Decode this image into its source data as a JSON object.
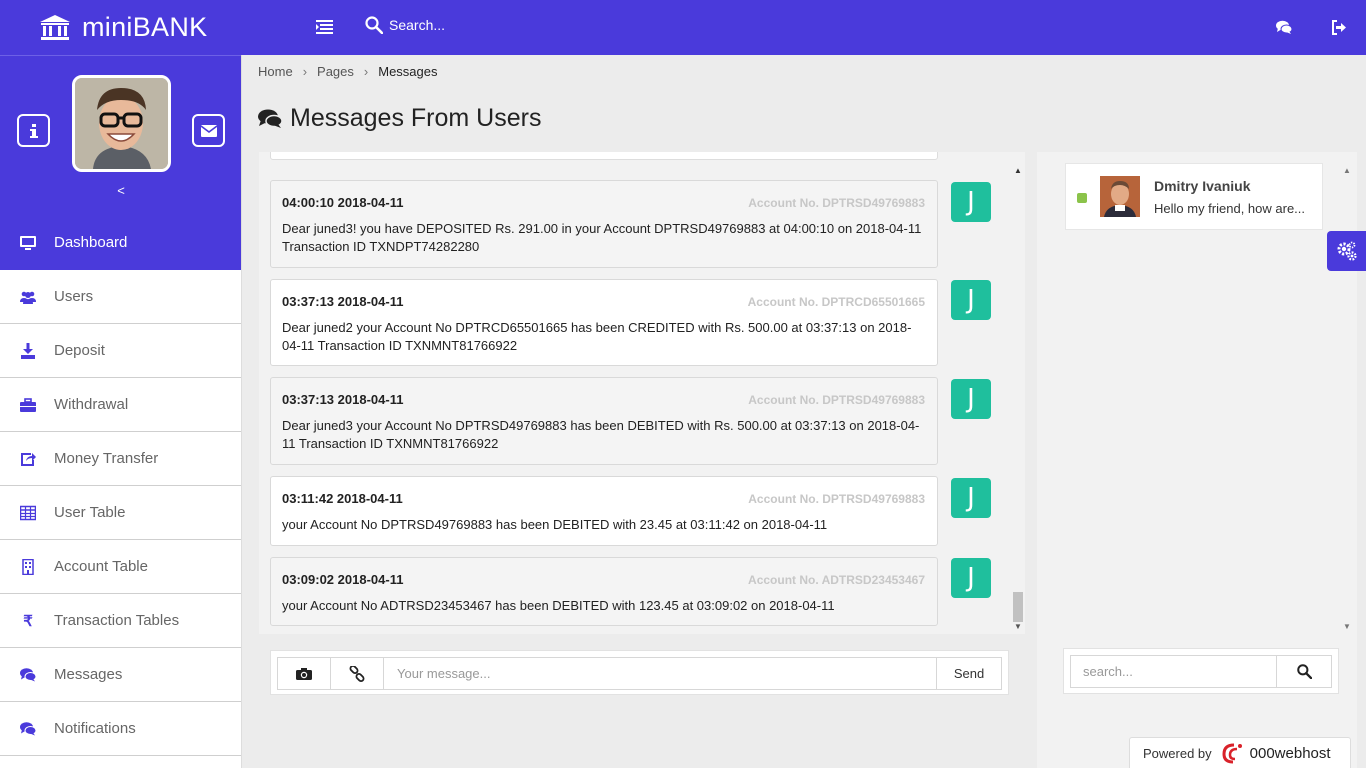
{
  "brand": {
    "name": "miniBANK"
  },
  "header": {
    "search_placeholder": "Search...",
    "icons": [
      "bank-icon",
      "menu-toggle-icon",
      "search-icon",
      "chat-icon",
      "logout-icon"
    ]
  },
  "profile": {
    "collapse_symbol": "<"
  },
  "sidebar": {
    "items": [
      {
        "label": "Dashboard",
        "icon": "desktop-icon",
        "active": true
      },
      {
        "label": "Users",
        "icon": "users-icon"
      },
      {
        "label": "Deposit",
        "icon": "download-icon"
      },
      {
        "label": "Withdrawal",
        "icon": "briefcase-icon"
      },
      {
        "label": "Money Transfer",
        "icon": "share-icon"
      },
      {
        "label": "User Table",
        "icon": "table-icon"
      },
      {
        "label": "Account Table",
        "icon": "building-icon"
      },
      {
        "label": "Transaction Tables",
        "icon": "rupee-icon",
        "glyph": "₹"
      },
      {
        "label": "Messages",
        "icon": "comments-icon"
      },
      {
        "label": "Notifications",
        "icon": "comments-icon"
      }
    ]
  },
  "breadcrumb": {
    "home": "Home",
    "pages": "Pages",
    "current": "Messages",
    "separator": "›"
  },
  "page": {
    "title": "Messages From Users"
  },
  "messages": [
    {
      "time": "04:00:10 2018-04-11",
      "account": "Account No. DPTRSD49769883",
      "body": "Dear juned3! you have DEPOSITED Rs. 291.00 in your Account DPTRSD49769883 at 04:00:10 on 2018-04-11 Transaction ID TXNDPT74282280",
      "avatar": "J"
    },
    {
      "time": "03:37:13 2018-04-11",
      "account": "Account No. DPTRCD65501665",
      "body": "Dear juned2 your Account No DPTRCD65501665 has been CREDITED with Rs. 500.00 at 03:37:13 on 2018-04-11 Transaction ID TXNMNT81766922",
      "avatar": "J"
    },
    {
      "time": "03:37:13 2018-04-11",
      "account": "Account No. DPTRSD49769883",
      "body": "Dear juned3 your Account No DPTRSD49769883 has been DEBITED with Rs. 500.00 at 03:37:13 on 2018-04-11 Transaction ID TXNMNT81766922",
      "avatar": "J"
    },
    {
      "time": "03:11:42 2018-04-11",
      "account": "Account No. DPTRSD49769883",
      "body": "your Account No DPTRSD49769883 has been DEBITED with 23.45 at 03:11:42 on 2018-04-11",
      "avatar": "J"
    },
    {
      "time": "03:09:02 2018-04-11",
      "account": "Account No. ADTRSD23453467",
      "body": "your Account No ADTRSD23453467 has been DEBITED with 123.45 at 03:09:02 on 2018-04-11",
      "avatar": "J"
    }
  ],
  "composer": {
    "placeholder": "Your message...",
    "send_label": "Send"
  },
  "contacts": [
    {
      "name": "Dmitry Ivaniuk",
      "preview": "Hello my friend, how are...",
      "status": "online"
    }
  ],
  "side_search": {
    "placeholder": "search..."
  },
  "footer": {
    "powered_by": "Powered by",
    "host": "000webhost"
  },
  "colors": {
    "primary": "#4a3adb",
    "avatar_bg": "#1fbf9d",
    "online": "#8bc34a"
  }
}
